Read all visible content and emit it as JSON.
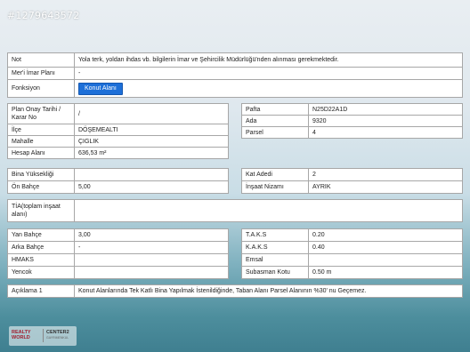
{
  "watermark": "#1279643572",
  "top": {
    "not_label": "Not",
    "not_value": "Yola terk, yoldan ihdas vb. bilgilerin İmar ve Şehircilik Müdürlüğü'nden alınması gerekmektedir.",
    "meri_label": "Mer'i İmar Planı",
    "meri_value": "-",
    "fonksiyon_label": "Fonksiyon",
    "fonksiyon_button": "Konut Alanı"
  },
  "left1": {
    "plan_label": "Plan Onay Tarihi / Karar No",
    "plan_value": "/",
    "ilce_label": "İlçe",
    "ilce_value": "DÖŞEMEALTI",
    "mahalle_label": "Mahalle",
    "mahalle_value": "ÇIGLIK",
    "hesap_label": "Hesap Alanı",
    "hesap_value": "636,53 m²"
  },
  "right1": {
    "pafta_label": "Pafta",
    "pafta_value": "N25D22A1D",
    "ada_label": "Ada",
    "ada_value": "9320",
    "parsel_label": "Parsel",
    "parsel_value": "4"
  },
  "left2": {
    "bina_label": "Bina Yüksekliği",
    "bina_value": "",
    "on_label": "Ön Bahçe",
    "on_value": "5,00"
  },
  "right2": {
    "kat_label": "Kat Adedi",
    "kat_value": "2",
    "insaat_label": "İnşaat Nizamı",
    "insaat_value": "AYRIK"
  },
  "tia": {
    "label": "TİA(toplam inşaat alanı)",
    "value": ""
  },
  "left3": {
    "yan_label": "Yan Bahçe",
    "yan_value": "3,00",
    "arka_label": "Arka Bahçe",
    "arka_value": "-",
    "hmaks_label": "HMAKS",
    "hmaks_value": "",
    "yencok_label": "Yencok",
    "yencok_value": ""
  },
  "right3": {
    "taks_label": "T.A.K.S",
    "taks_value": "0.20",
    "kaks_label": "K.A.K.S",
    "kaks_value": "0.40",
    "emsal_label": "Emsal",
    "emsal_value": "",
    "subasman_label": "Subasman Kotu",
    "subasman_value": "0.50 m"
  },
  "aciklama": {
    "label": "Açıklama 1",
    "value": "Konut Alanlarında Tek Katlı Bina Yapılmak İstenildiğinde, Taban Alanı Parsel Alanının %30' nu Geçemez."
  },
  "logo": {
    "line1": "REALTY",
    "line2": "WORLD",
    "brand": "CENTER2",
    "sub": "GAYRIMENKUL"
  }
}
